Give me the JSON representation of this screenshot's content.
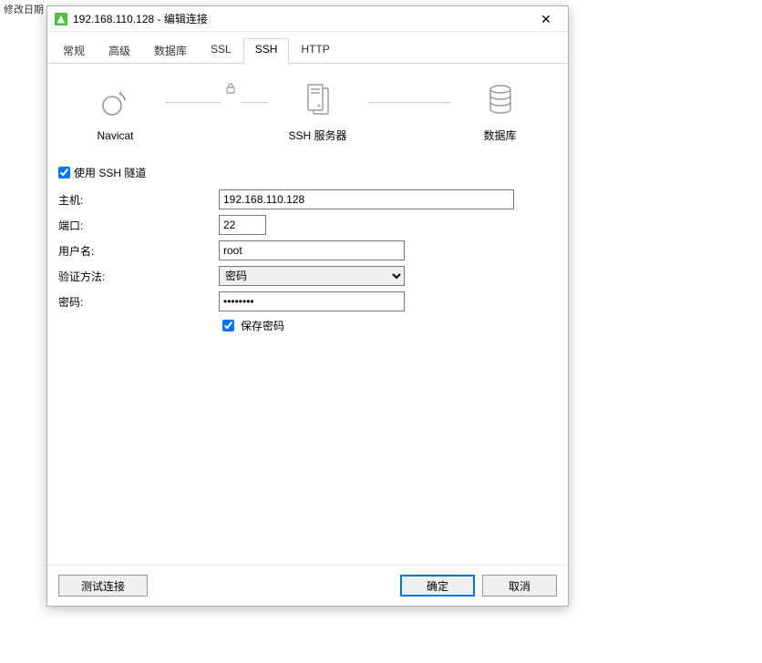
{
  "background": {
    "col1": "修改日期"
  },
  "titlebar": {
    "title": "192.168.110.128 - 编辑连接"
  },
  "tabs": [
    {
      "label": "常规",
      "active": false
    },
    {
      "label": "高级",
      "active": false
    },
    {
      "label": "数据库",
      "active": false
    },
    {
      "label": "SSL",
      "active": false
    },
    {
      "label": "SSH",
      "active": true
    },
    {
      "label": "HTTP",
      "active": false
    }
  ],
  "topology": {
    "navicat": "Navicat",
    "ssh": "SSH 服务器",
    "db": "数据库"
  },
  "form": {
    "use_ssh_label": "使用 SSH 隧道",
    "use_ssh_checked": true,
    "host_label": "主机:",
    "host_value": "192.168.110.128",
    "port_label": "端口:",
    "port_value": "22",
    "user_label": "用户名:",
    "user_value": "root",
    "auth_label": "验证方法:",
    "auth_value": "密码",
    "pwd_label": "密码:",
    "pwd_value": "••••••••",
    "save_pwd_label": "保存密码",
    "save_pwd_checked": true
  },
  "footer": {
    "test": "测试连接",
    "ok": "确定",
    "cancel": "取消"
  }
}
